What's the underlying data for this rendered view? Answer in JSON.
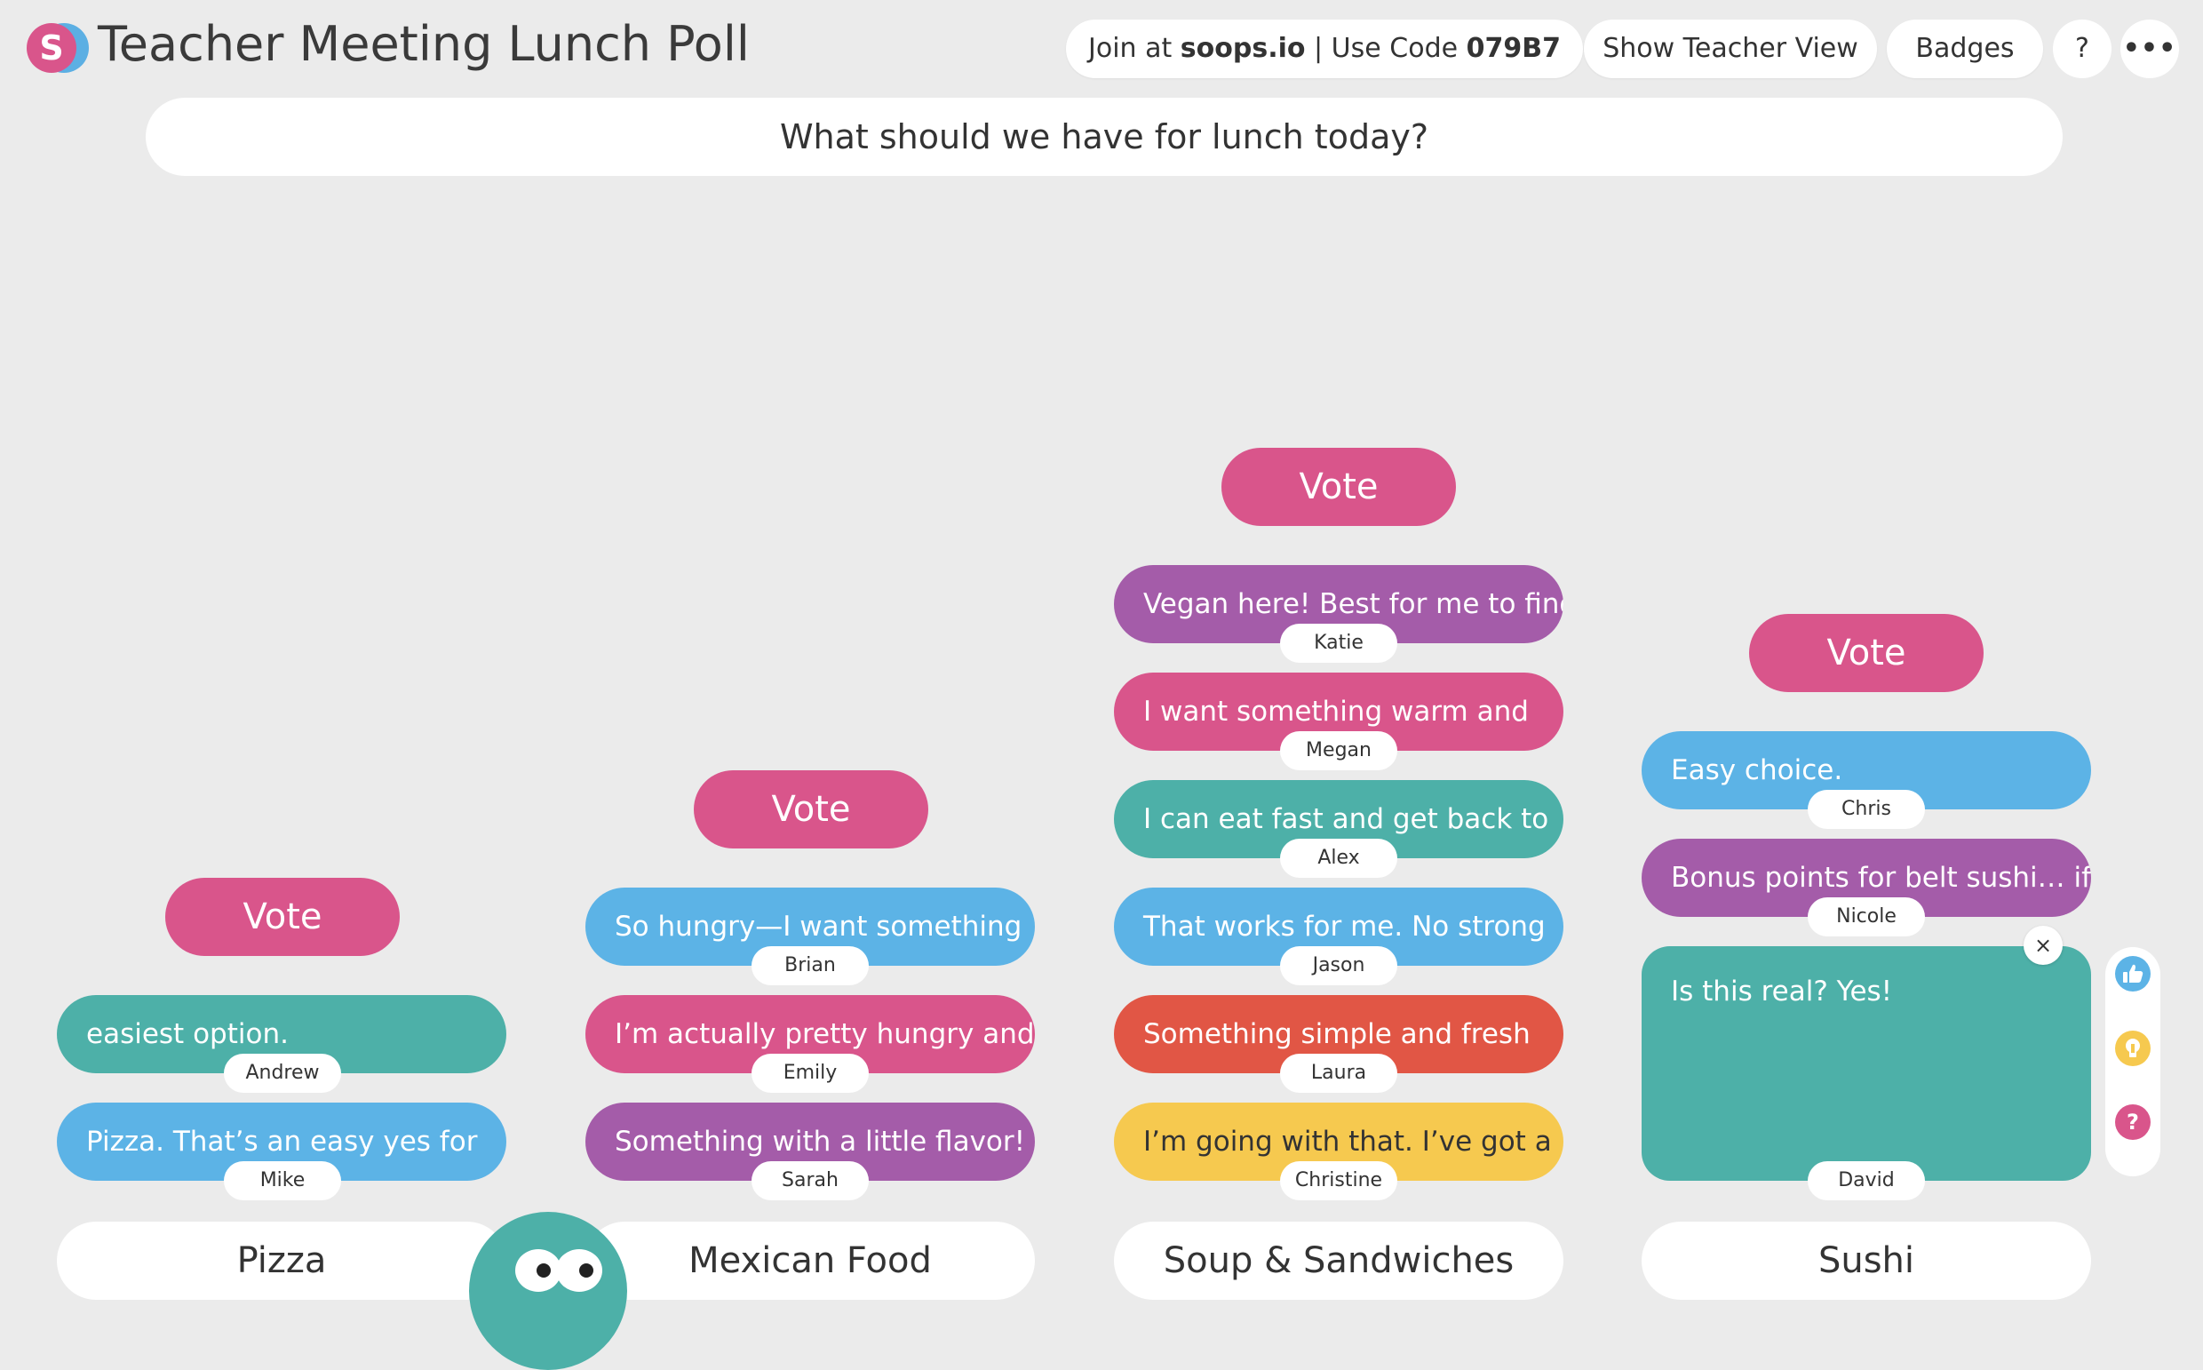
{
  "header": {
    "logo_letter": "S",
    "title": "Teacher Meeting Lunch Poll",
    "join_prefix": "Join at ",
    "join_site": "soops.io",
    "join_mid": " | Use Code ",
    "join_code": "079B7",
    "teacher_view_label": "Show Teacher View",
    "badges_label": "Badges",
    "help_label": "?",
    "more_label": "•••"
  },
  "question": "What should we have for lunch today?",
  "vote_label": "Vote",
  "columns": [
    {
      "label": "Pizza",
      "responses": [
        {
          "text": "easiest option.",
          "author": "Andrew",
          "color": "teal"
        },
        {
          "text": "Pizza. That’s an easy yes for",
          "author": "Mike",
          "color": "blue"
        }
      ]
    },
    {
      "label": "Mexican Food",
      "responses": [
        {
          "text": "So hungry—I want something",
          "author": "Brian",
          "color": "blue"
        },
        {
          "text": "I’m actually pretty hungry and",
          "author": "Emily",
          "color": "pink"
        },
        {
          "text": "Something with a little flavor!",
          "author": "Sarah",
          "color": "purple"
        }
      ]
    },
    {
      "label": "Soup & Sandwiches",
      "responses": [
        {
          "text": "Vegan here! Best for me to find",
          "author": "Katie",
          "color": "purple"
        },
        {
          "text": "I want something warm and",
          "author": "Megan",
          "color": "pink"
        },
        {
          "text": "I can eat fast and get back to",
          "author": "Alex",
          "color": "teal"
        },
        {
          "text": "That works for me. No strong",
          "author": "Jason",
          "color": "blue"
        },
        {
          "text": "Something simple and fresh",
          "author": "Laura",
          "color": "orange"
        },
        {
          "text": "I’m going with that. I’ve got a",
          "author": "Christine",
          "color": "yellow"
        }
      ]
    },
    {
      "label": "Sushi",
      "responses": [
        {
          "text": "Easy choice.",
          "author": "Chris",
          "color": "blue"
        },
        {
          "text": "Bonus points for belt sushi… if",
          "author": "Nicole",
          "color": "purple"
        },
        {
          "text": "Is this real? Yes!",
          "author": "David",
          "color": "teal"
        }
      ]
    }
  ],
  "expanded_card": {
    "close_label": "×"
  },
  "reactions": [
    "thumbs-up-icon",
    "lightbulb-icon",
    "question-icon"
  ],
  "colors": {
    "pink": "#d9558b",
    "blue": "#5cb3e6",
    "teal": "#4db0a8",
    "purple": "#a45ca9",
    "orange": "#e15645",
    "yellow": "#f6c94f",
    "background": "#ebebeb"
  }
}
